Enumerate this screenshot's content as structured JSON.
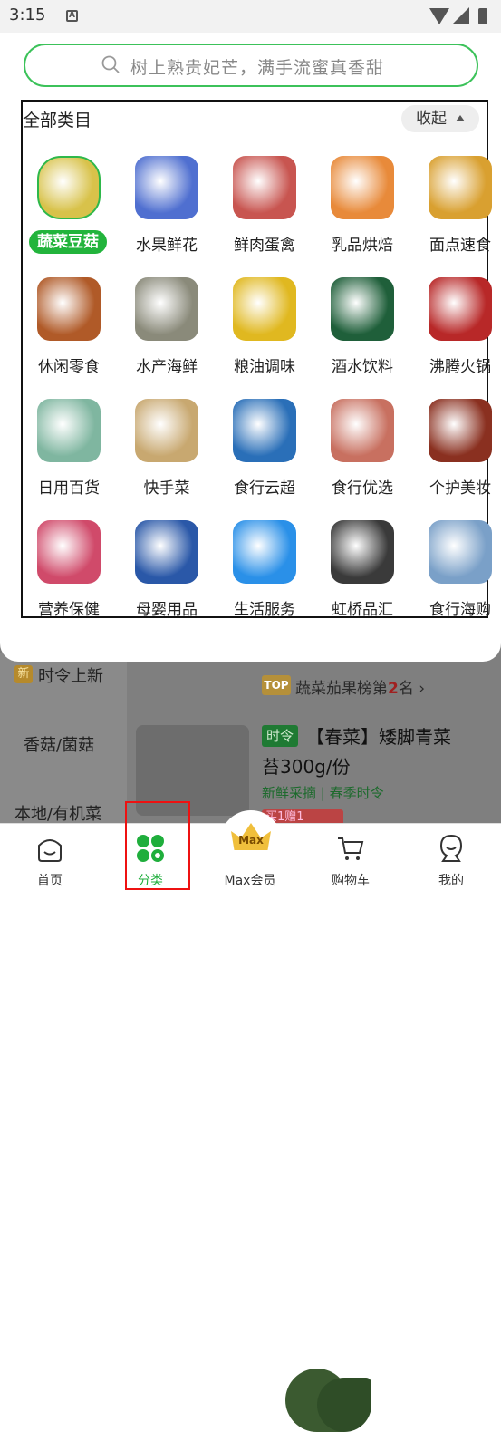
{
  "status": {
    "time": "3:15",
    "notif_icon_letter": "A"
  },
  "search": {
    "placeholder": "树上熟贵妃芒，满手流蜜真香甜"
  },
  "panel": {
    "title": "全部类目",
    "collapse_label": "收起",
    "categories": [
      {
        "label": "蔬菜豆菇",
        "icon": "vegetables-icon",
        "selected": true,
        "color": "#d8c24a"
      },
      {
        "label": "水果鲜花",
        "icon": "fruit-icon",
        "color": "#4f6fd0"
      },
      {
        "label": "鲜肉蛋禽",
        "icon": "meat-icon",
        "color": "#c85550"
      },
      {
        "label": "乳品烘焙",
        "icon": "dairy-icon",
        "color": "#e88a3a"
      },
      {
        "label": "面点速食",
        "icon": "bakery-icon",
        "color": "#d9a030"
      },
      {
        "label": "休闲零食",
        "icon": "snacks-icon",
        "color": "#b05a28"
      },
      {
        "label": "水产海鲜",
        "icon": "seafood-icon",
        "color": "#8a8a7a"
      },
      {
        "label": "粮油调味",
        "icon": "oil-icon",
        "color": "#e0b820"
      },
      {
        "label": "酒水饮料",
        "icon": "drinks-icon",
        "color": "#1f5f3a"
      },
      {
        "label": "沸腾火锅",
        "icon": "hotpot-icon",
        "color": "#b82828"
      },
      {
        "label": "日用百货",
        "icon": "daily-goods-icon",
        "color": "#7fb6a0"
      },
      {
        "label": "快手菜",
        "icon": "quick-dish-icon",
        "color": "#c8a870"
      },
      {
        "label": "食行云超",
        "icon": "electronics-icon",
        "color": "#2a6fb8"
      },
      {
        "label": "食行优选",
        "icon": "selection-icon",
        "color": "#c87060"
      },
      {
        "label": "个护美妆",
        "icon": "beauty-icon",
        "color": "#8a3020"
      },
      {
        "label": "营养保健",
        "icon": "health-icon",
        "color": "#d04a6a"
      },
      {
        "label": "母婴用品",
        "icon": "baby-icon",
        "color": "#2a58a8"
      },
      {
        "label": "生活服务",
        "icon": "service-icon",
        "color": "#2a90e8"
      },
      {
        "label": "虹桥品汇",
        "icon": "appliance-icon",
        "color": "#3a3a3a"
      },
      {
        "label": "食行海购",
        "icon": "import-icon",
        "color": "#7aa0c8"
      }
    ]
  },
  "background": {
    "nav_items": [
      "时令上新",
      "香菇/菌菇",
      "本地/有机菜"
    ],
    "new_tag": "新",
    "rank_tag": "TOP",
    "rank_text_prefix": "蔬菜茄果榜第",
    "rank_number": "2",
    "rank_text_suffix": "名 ›",
    "season_tag": "时令",
    "product_title_1": "【春菜】矮脚青菜",
    "product_title_2": "苔300g/份",
    "product_sub": "新鲜采摘 | 春季时令",
    "gift": "买1赠1"
  },
  "tabbar": {
    "tabs": [
      {
        "label": "首页",
        "icon": "home-icon"
      },
      {
        "label": "分类",
        "icon": "category-icon",
        "active": true
      },
      {
        "label": "Max会员",
        "icon": "crown-icon"
      },
      {
        "label": "购物车",
        "icon": "cart-icon"
      },
      {
        "label": "我的",
        "icon": "profile-icon"
      }
    ],
    "max_badge": "Max"
  },
  "colors": {
    "accent": "#22b43c",
    "highlight_box": "#e11111"
  }
}
